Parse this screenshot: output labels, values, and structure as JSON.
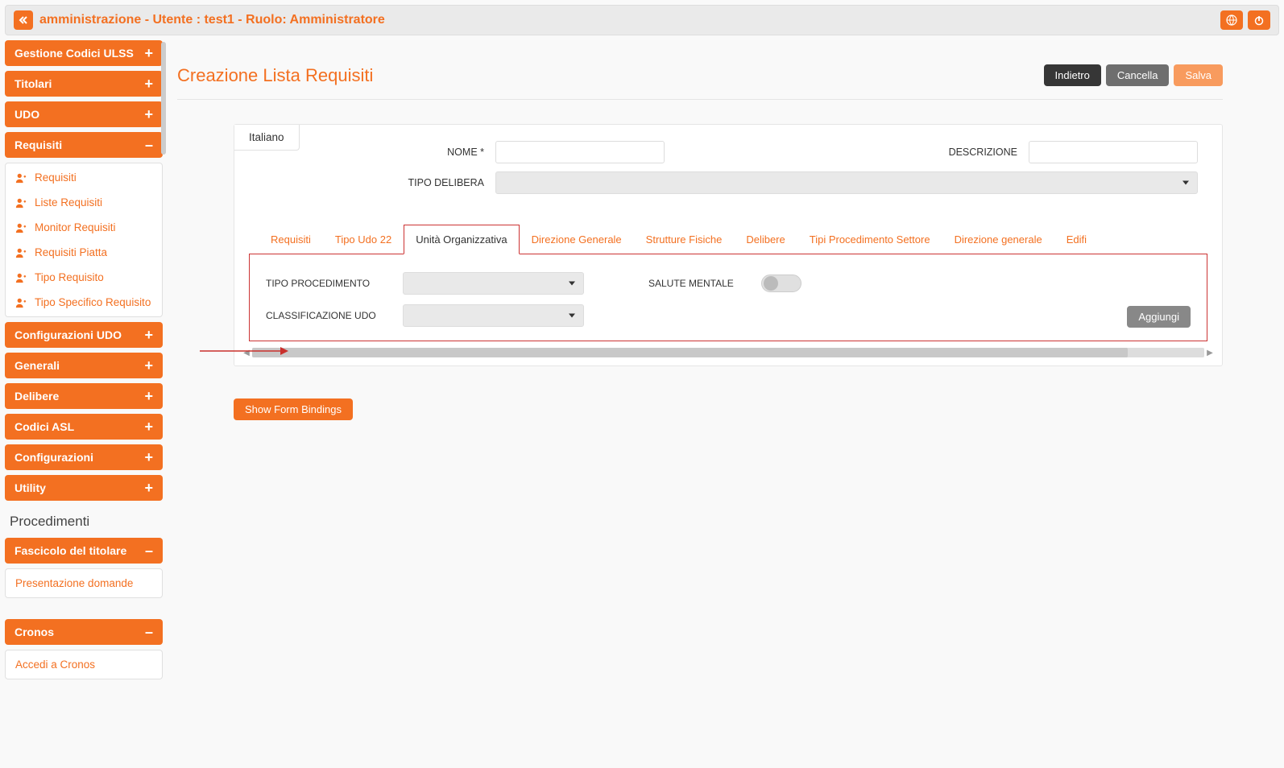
{
  "header": {
    "title": "amministrazione - Utente : test1 - Ruolo: Amministratore"
  },
  "sidebar": {
    "sections": [
      {
        "label": "Gestione Codici ULSS",
        "expanded": false
      },
      {
        "label": "Titolari",
        "expanded": false
      },
      {
        "label": "UDO",
        "expanded": false
      },
      {
        "label": "Requisiti",
        "expanded": true,
        "items": [
          {
            "label": "Requisiti"
          },
          {
            "label": "Liste Requisiti"
          },
          {
            "label": "Monitor Requisiti"
          },
          {
            "label": "Requisiti Piatta"
          },
          {
            "label": "Tipo Requisito"
          },
          {
            "label": "Tipo Specifico Requisito"
          }
        ]
      },
      {
        "label": "Configurazioni UDO",
        "expanded": false
      },
      {
        "label": "Generali",
        "expanded": false
      },
      {
        "label": "Delibere",
        "expanded": false
      },
      {
        "label": "Codici ASL",
        "expanded": false
      },
      {
        "label": "Configurazioni",
        "expanded": false
      },
      {
        "label": "Utility",
        "expanded": false
      }
    ],
    "procedimenti_title": "Procedimenti",
    "fascicolo": {
      "label": "Fascicolo del titolare",
      "items": [
        {
          "label": "Presentazione domande"
        }
      ]
    },
    "cronos": {
      "label": "Cronos",
      "items": [
        {
          "label": "Accedi a Cronos"
        }
      ]
    }
  },
  "page": {
    "title": "Creazione Lista Requisiti",
    "buttons": {
      "back": "Indietro",
      "cancel": "Cancella",
      "save": "Salva"
    },
    "lang_tab": "Italiano",
    "fields": {
      "nome_label": "NOME *",
      "descrizione_label": "DESCRIZIONE",
      "tipo_delibera_label": "TIPO DELIBERA"
    },
    "tabs": [
      "Requisiti",
      "Tipo Udo 22",
      "Unità Organizzativa",
      "Direzione Generale",
      "Strutture Fisiche",
      "Delibere",
      "Tipi Procedimento Settore",
      "Direzione generale",
      "Edifi"
    ],
    "active_tab": "Unità Organizzativa",
    "tab_body": {
      "tipo_procedimento_label": "TIPO PROCEDIMENTO",
      "salute_mentale_label": "SALUTE MENTALE",
      "classificazione_udo_label": "CLASSIFICAZIONE UDO",
      "aggiungi": "Aggiungi"
    },
    "show_bindings": "Show Form Bindings"
  }
}
